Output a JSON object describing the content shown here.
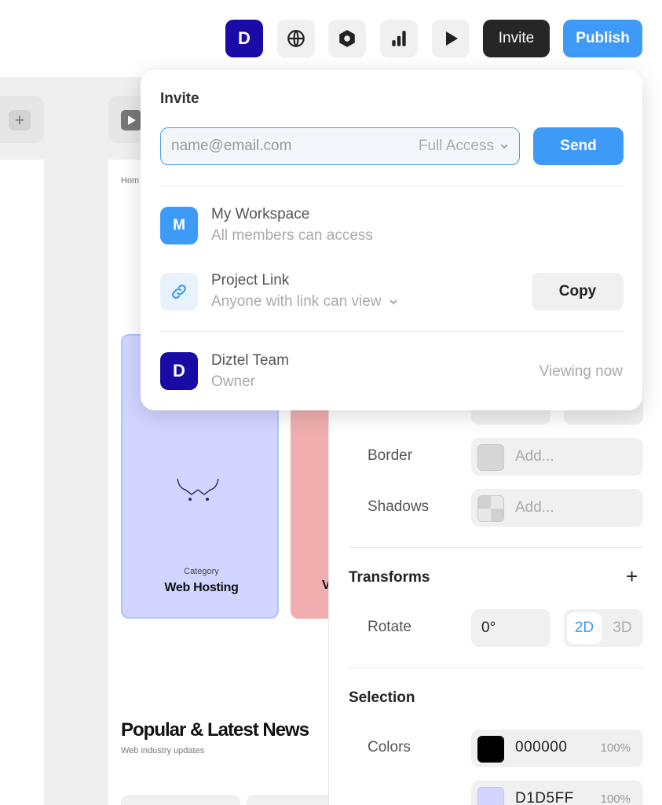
{
  "toolbar": {
    "avatar_initial": "D",
    "invite_label": "Invite",
    "publish_label": "Publish",
    "icons": [
      "globe-icon",
      "hexagon-icon",
      "bar-chart-icon",
      "play-icon"
    ]
  },
  "canvas": {
    "breadcrumb": "Hom",
    "card1": {
      "category": "Category",
      "title": "Web Hosting"
    },
    "card2": {
      "title_fragment": "V"
    },
    "news": {
      "title": "Popular & Latest News",
      "subtitle": "Web industry updates"
    }
  },
  "panel": {
    "border_label": "Border",
    "border_placeholder": "Add...",
    "shadows_label": "Shadows",
    "shadows_placeholder": "Add...",
    "transforms_title": "Transforms",
    "rotate_label": "Rotate",
    "rotate_value": "0°",
    "mode_2d": "2D",
    "mode_3d": "3D",
    "selection_title": "Selection",
    "colors_label": "Colors",
    "colors": [
      {
        "hex": "000000",
        "opacity": "100%",
        "swatch": "#000000"
      },
      {
        "hex": "D1D5FF",
        "opacity": "100%",
        "swatch": "#d1d5ff"
      }
    ]
  },
  "invite": {
    "title": "Invite",
    "email_placeholder": "name@email.com",
    "access_level": "Full Access",
    "send_label": "Send",
    "workspace": {
      "initial": "M",
      "name": "My Workspace",
      "subtitle": "All members can access"
    },
    "project_link": {
      "name": "Project Link",
      "subtitle": "Anyone with link can view",
      "copy_label": "Copy"
    },
    "team": {
      "initial": "D",
      "name": "Diztel Team",
      "role": "Owner",
      "status": "Viewing now"
    }
  },
  "colors": {
    "accent": "#3d9bf7",
    "avatar_dark": "#1a0aa6",
    "card_purple": "#d1d5ff",
    "card_red": "#f0aeae"
  }
}
